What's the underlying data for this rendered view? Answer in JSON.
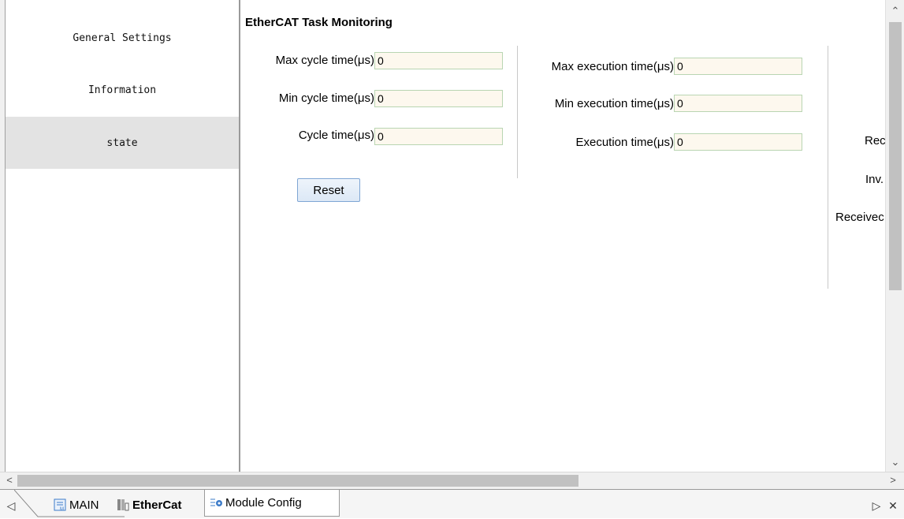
{
  "nav": {
    "items": [
      {
        "label": "General Settings",
        "selected": false
      },
      {
        "label": "Information",
        "selected": false
      },
      {
        "label": "state",
        "selected": true
      }
    ]
  },
  "monitoring": {
    "title": "EtherCAT Task Monitoring",
    "cycle_fields": [
      {
        "label": "Max cycle time(μs)",
        "value": "0"
      },
      {
        "label": "Min cycle time(μs)",
        "value": "0"
      },
      {
        "label": "Cycle time(μs)",
        "value": "0"
      }
    ],
    "execution_fields": [
      {
        "label": "Max execution time(μs)",
        "value": "0"
      },
      {
        "label": "Min execution time(μs)",
        "value": "0"
      },
      {
        "label": "Execution time(μs)",
        "value": "0"
      }
    ],
    "reset_label": "Reset",
    "cut_labels": [
      "Rec",
      "Inv.",
      "Receivec"
    ]
  },
  "tabs": [
    {
      "label": "MAIN",
      "icon": "main-program-icon",
      "active": false
    },
    {
      "label": "EtherCat",
      "icon": "ethercat-icon",
      "active": true
    },
    {
      "label": "Module Config",
      "icon": "module-config-icon",
      "active": false
    }
  ],
  "colors": {
    "input_bg": "#fdf8ee",
    "input_border": "#b9d5b2",
    "selected_nav": "#e3e3e3",
    "button_border": "#7fa6d4"
  }
}
